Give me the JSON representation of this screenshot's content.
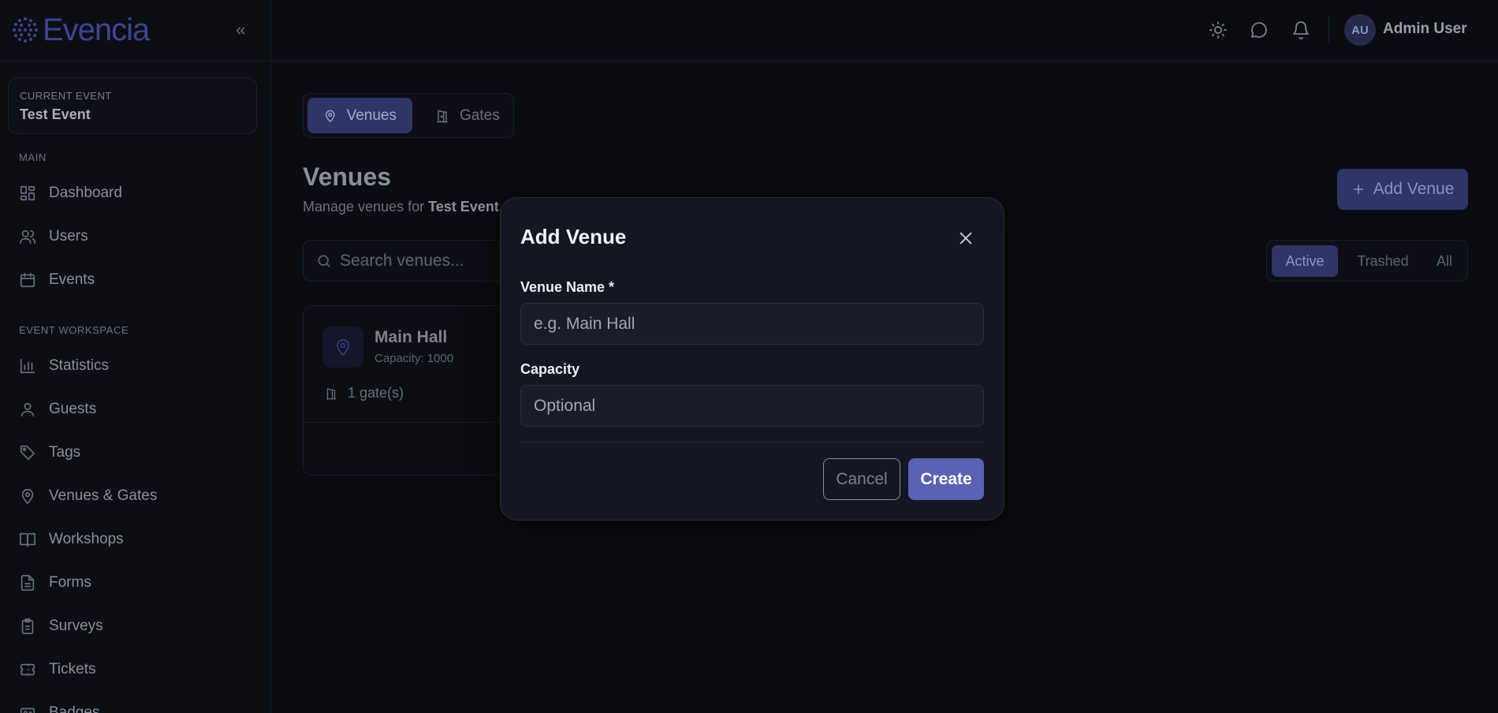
{
  "app": {
    "name": "Evencia"
  },
  "sidebar": {
    "current_event_label": "CURRENT EVENT",
    "current_event_name": "Test Event",
    "sections": [
      {
        "title": "MAIN"
      },
      {
        "title": "EVENT WORKSPACE"
      }
    ],
    "main_items": [
      {
        "label": "Dashboard",
        "icon": "dashboard-icon"
      },
      {
        "label": "Users",
        "icon": "users-icon"
      },
      {
        "label": "Events",
        "icon": "calendar-icon"
      }
    ],
    "workspace_items": [
      {
        "label": "Statistics",
        "icon": "bar-chart-icon"
      },
      {
        "label": "Guests",
        "icon": "user-icon"
      },
      {
        "label": "Tags",
        "icon": "tag-icon"
      },
      {
        "label": "Venues & Gates",
        "icon": "map-pin-icon"
      },
      {
        "label": "Workshops",
        "icon": "book-icon"
      },
      {
        "label": "Forms",
        "icon": "file-text-icon"
      },
      {
        "label": "Surveys",
        "icon": "clipboard-icon"
      },
      {
        "label": "Tickets",
        "icon": "ticket-icon"
      },
      {
        "label": "Badges",
        "icon": "badge-icon"
      }
    ]
  },
  "topbar": {
    "avatar_initials": "AU",
    "user_name": "Admin User"
  },
  "main": {
    "tabs": [
      {
        "label": "Venues",
        "active": true
      },
      {
        "label": "Gates",
        "active": false
      }
    ],
    "title": "Venues",
    "subtitle_prefix": "Manage venues for ",
    "subtitle_event": "Test Event",
    "add_button_label": "Add Venue",
    "search_placeholder": "Search venues...",
    "filters": [
      {
        "label": "Active",
        "active": true
      },
      {
        "label": "Trashed",
        "active": false
      },
      {
        "label": "All",
        "active": false
      }
    ],
    "venue_card": {
      "name": "Main Hall",
      "capacity": "Capacity: 1000",
      "gates": "1 gate(s)"
    }
  },
  "modal": {
    "title": "Add Venue",
    "name_label": "Venue Name *",
    "name_placeholder": "e.g. Main Hall",
    "capacity_label": "Capacity",
    "capacity_placeholder": "Optional",
    "cancel_label": "Cancel",
    "create_label": "Create"
  },
  "colors": {
    "accent": "#5a62b3",
    "background": "#0b0c12",
    "modal_bg": "#141621"
  }
}
